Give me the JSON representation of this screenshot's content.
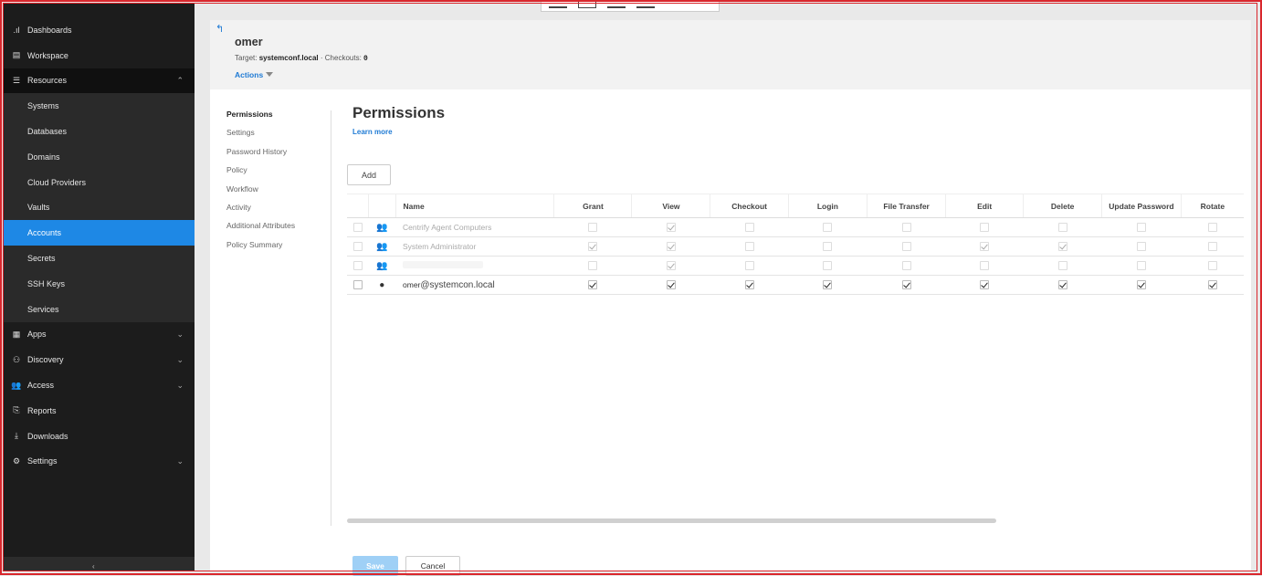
{
  "sidebar": {
    "items": [
      {
        "label": "Dashboards",
        "icon": "bar-chart-icon"
      },
      {
        "label": "Workspace",
        "icon": "workspace-icon"
      },
      {
        "label": "Resources",
        "icon": "list-icon"
      }
    ],
    "resources_sub": [
      {
        "label": "Systems"
      },
      {
        "label": "Databases"
      },
      {
        "label": "Domains"
      },
      {
        "label": "Cloud Providers"
      },
      {
        "label": "Vaults"
      },
      {
        "label": "Accounts"
      },
      {
        "label": "Secrets"
      },
      {
        "label": "SSH Keys"
      },
      {
        "label": "Services"
      }
    ],
    "more_items": [
      {
        "label": "Apps",
        "icon": "apps-grid-icon"
      },
      {
        "label": "Discovery",
        "icon": "discovery-icon"
      },
      {
        "label": "Access",
        "icon": "users-icon"
      },
      {
        "label": "Reports",
        "icon": "report-icon"
      },
      {
        "label": "Downloads",
        "icon": "download-icon"
      },
      {
        "label": "Settings",
        "icon": "gear-icon"
      }
    ]
  },
  "header": {
    "title": "omer",
    "target_label": "Target:",
    "target_value": "systemconf.local",
    "separator": "·",
    "checkouts_label": "Checkouts:",
    "checkouts_value": "0",
    "actions_label": "Actions"
  },
  "subnav": [
    "Permissions",
    "Settings",
    "Password History",
    "Policy",
    "Workflow",
    "Activity",
    "Additional Attributes",
    "Policy Summary"
  ],
  "content": {
    "title": "Permissions",
    "learn_more": "Learn more",
    "add_label": "Add",
    "columns": [
      "Name",
      "Grant",
      "View",
      "Checkout",
      "Login",
      "File Transfer",
      "Edit",
      "Delete",
      "Update Password",
      "Rotate"
    ],
    "rows": [
      {
        "name": "Centrify Agent Computers",
        "type": "group",
        "perms": [
          false,
          true,
          false,
          false,
          false,
          false,
          false,
          false,
          false
        ]
      },
      {
        "name": "System Administrator",
        "type": "group",
        "perms": [
          true,
          true,
          false,
          false,
          false,
          true,
          true,
          false,
          false
        ]
      },
      {
        "name": "",
        "type": "group",
        "perms": [
          false,
          true,
          false,
          false,
          false,
          false,
          false,
          false,
          false
        ]
      },
      {
        "name_prefix": "omer",
        "name": "@systemcon.local",
        "type": "user",
        "perms": [
          true,
          true,
          true,
          true,
          true,
          true,
          true,
          true,
          true
        ]
      }
    ],
    "save_label": "Save",
    "cancel_label": "Cancel"
  }
}
